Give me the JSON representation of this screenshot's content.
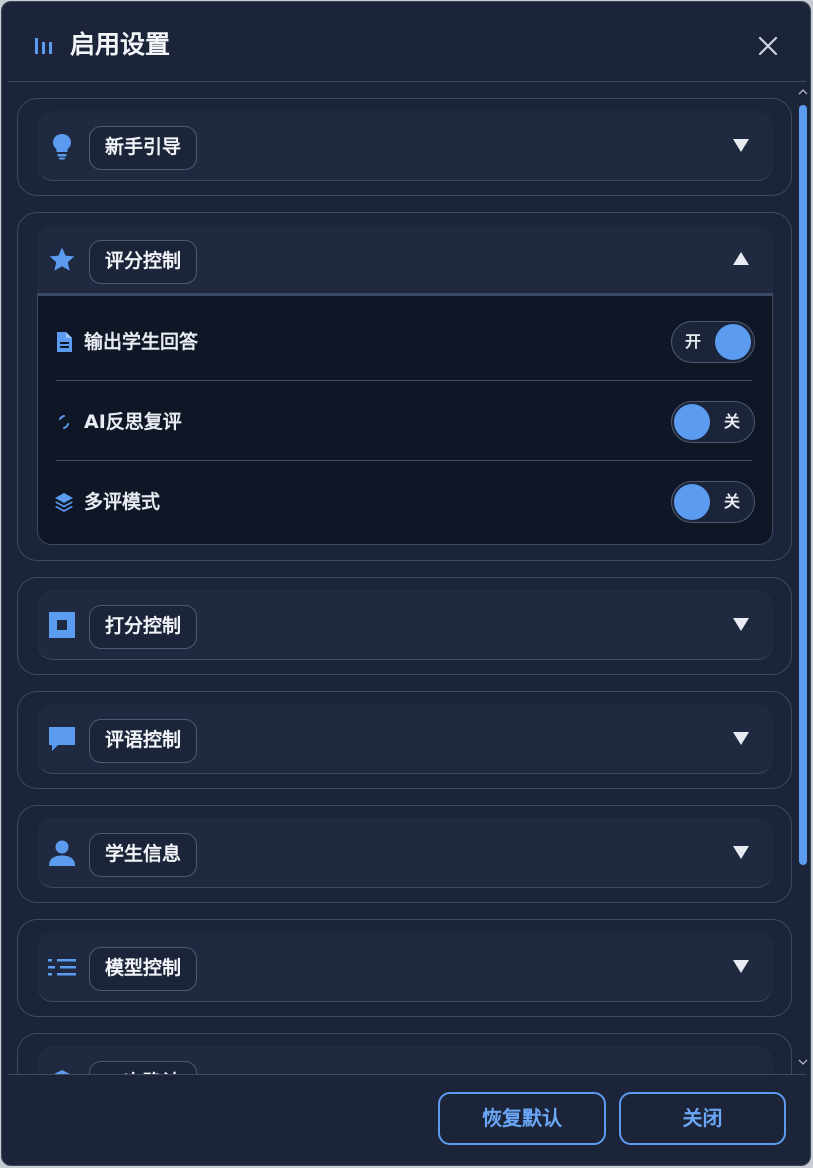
{
  "dialog": {
    "title": "启用设置",
    "title_icon": "bar-chart-icon",
    "close_icon": "close-icon"
  },
  "sections": [
    {
      "label": "新手引导",
      "icon": "lightbulb-icon",
      "expanded": false
    },
    {
      "label": "评分控制",
      "icon": "star-icon",
      "expanded": true
    },
    {
      "label": "打分控制",
      "icon": "square-icon",
      "expanded": false
    },
    {
      "label": "评语控制",
      "icon": "comment-icon",
      "expanded": false
    },
    {
      "label": "学生信息",
      "icon": "person-icon",
      "expanded": false
    },
    {
      "label": "模型控制",
      "icon": "list-settings-icon",
      "expanded": false
    },
    {
      "label": "二次确认",
      "icon": "graduation-cap-icon",
      "expanded": false
    }
  ],
  "score_control": {
    "rows": [
      {
        "label": "输出学生回答",
        "icon": "document-icon",
        "state": "on",
        "state_text": "开"
      },
      {
        "label": "AI反思复评",
        "icon": "spinner-icon",
        "state": "off",
        "state_text": "关"
      },
      {
        "label": "多评模式",
        "icon": "layers-icon",
        "state": "off",
        "state_text": "关"
      }
    ]
  },
  "footer": {
    "reset_label": "恢复默认",
    "close_label": "关闭"
  },
  "colors": {
    "accent": "#5b9bf0",
    "background": "#1b2438",
    "panel": "#0f1626",
    "border": "#3d4a60",
    "text": "#f2f4f8"
  }
}
